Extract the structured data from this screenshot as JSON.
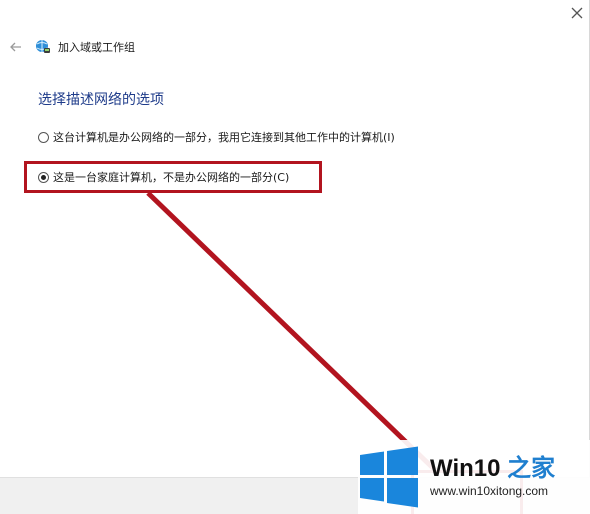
{
  "window": {
    "title": "加入域或工作组",
    "close_icon": "close-icon",
    "back_icon": "back-arrow-icon",
    "wizard_icon": "network-join-icon"
  },
  "page": {
    "heading": "选择描述网络的选项"
  },
  "options": [
    {
      "label": "这台计算机是办公网络的一部分，我用它连接到其他工作中的计算机(I)",
      "selected": false
    },
    {
      "label": "这是一台家庭计算机，不是办公网络的一部分(C)",
      "selected": true
    }
  ],
  "annotation": {
    "color": "#b2141f"
  },
  "watermark": {
    "brand_prefix": "Win10",
    "brand_suffix": " 之家",
    "url": "www.win10xitong.com",
    "accent_color": "#1f7fcf",
    "logo_color": "#1a86dc"
  }
}
